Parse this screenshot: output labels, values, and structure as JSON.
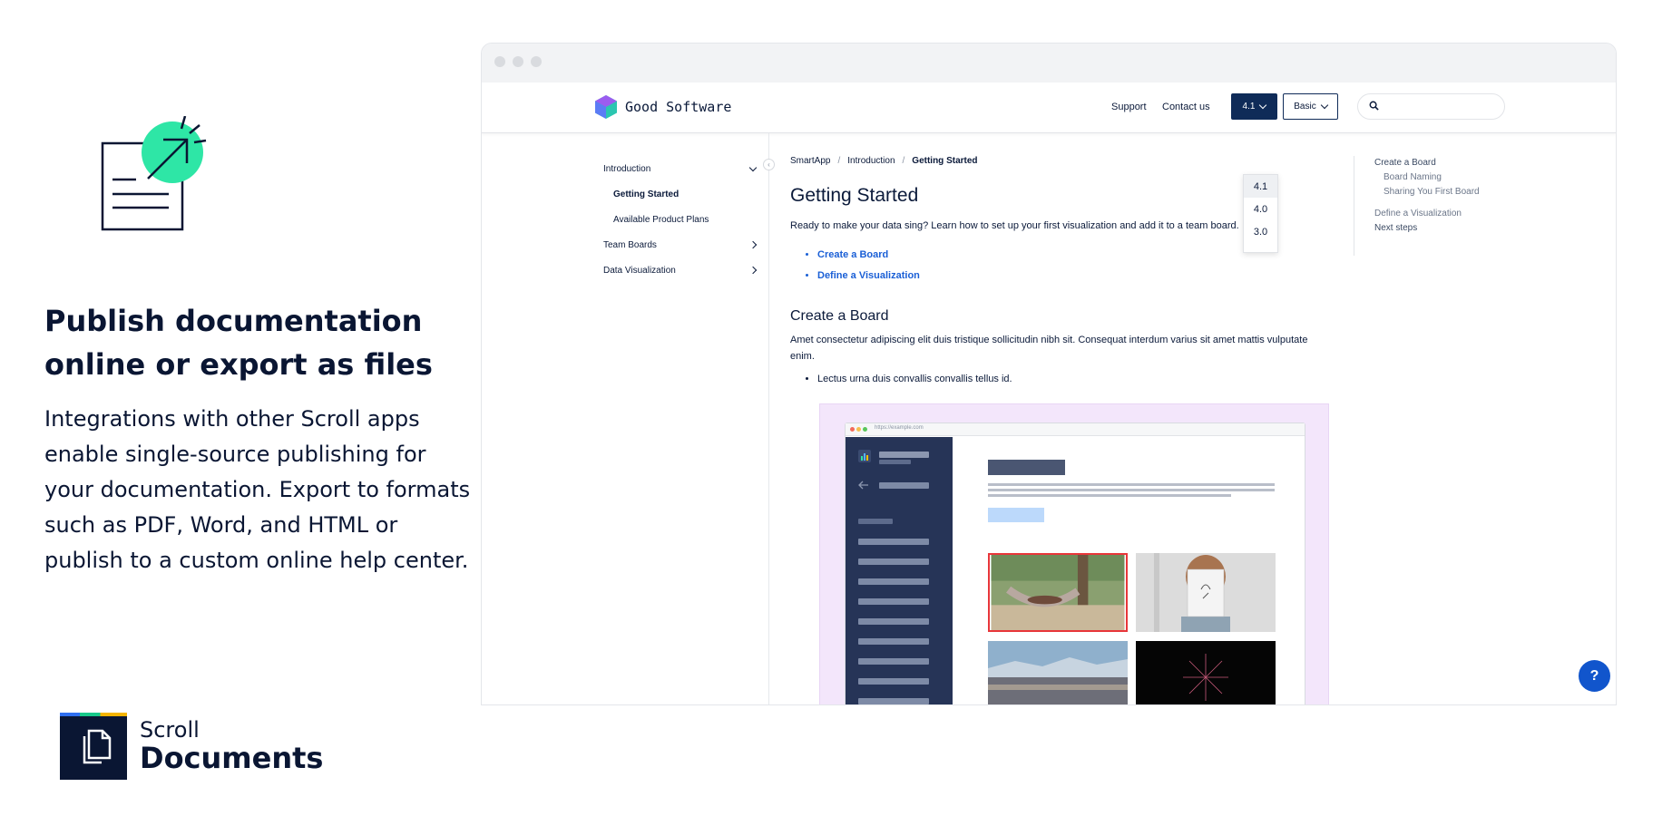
{
  "hero": {
    "headline": "Publish documentation online or export as files",
    "body": "Integrations with other Scroll apps enable single-source publishing for your documentation. Export to formats such as PDF, Word, and HTML or publish to a custom online help center.",
    "icon": "document-publish-icon",
    "accent_color": "#2ee6a6"
  },
  "brand": {
    "line1": "Scroll",
    "line2": "Documents",
    "icon": "documents-icon"
  },
  "site": {
    "logo_name": "Good Software",
    "nav": {
      "support": "Support",
      "contact": "Contact us"
    },
    "version_button": "4.1",
    "plan_button": "Basic",
    "version_options": [
      "4.1",
      "4.0",
      "3.0"
    ],
    "selected_version": "4.1",
    "search_placeholder": ""
  },
  "sidebar": {
    "items": [
      {
        "label": "Introduction",
        "expanded": true
      },
      {
        "label": "Getting Started",
        "current": true
      },
      {
        "label": "Available Product Plans"
      },
      {
        "label": "Team Boards",
        "expanded": false
      },
      {
        "label": "Data Visualization",
        "expanded": false
      }
    ]
  },
  "breadcrumb": [
    "SmartApp",
    "Introduction",
    "Getting Started"
  ],
  "article": {
    "title": "Getting Started",
    "intro": "Ready to make your data sing? Learn how to set up your first visualization and add it to a team board.",
    "links": [
      "Create a Board",
      "Define a Visualization"
    ],
    "section_title": "Create a Board",
    "section_text": "Amet consectetur adipiscing elit duis tristique sollicitudin nibh sit. Consequat interdum varius sit amet mattis vulputate enim.",
    "bullets": [
      "Lectus urna duis convallis convallis tellus id."
    ],
    "embedded_url": "https://example.com"
  },
  "toc": {
    "items": [
      {
        "label": "Create a Board",
        "level": 1
      },
      {
        "label": "Board Naming",
        "level": 2
      },
      {
        "label": "Sharing You First Board",
        "level": 2
      },
      {
        "label": "Define a Visualization",
        "level": 1
      },
      {
        "label": "Next steps",
        "level": 1
      }
    ]
  },
  "help_button": "?",
  "colors": {
    "navy": "#0f2b58",
    "link": "#1a5fd6",
    "help": "#1155cc",
    "figure_bg": "#f3e6fb"
  }
}
